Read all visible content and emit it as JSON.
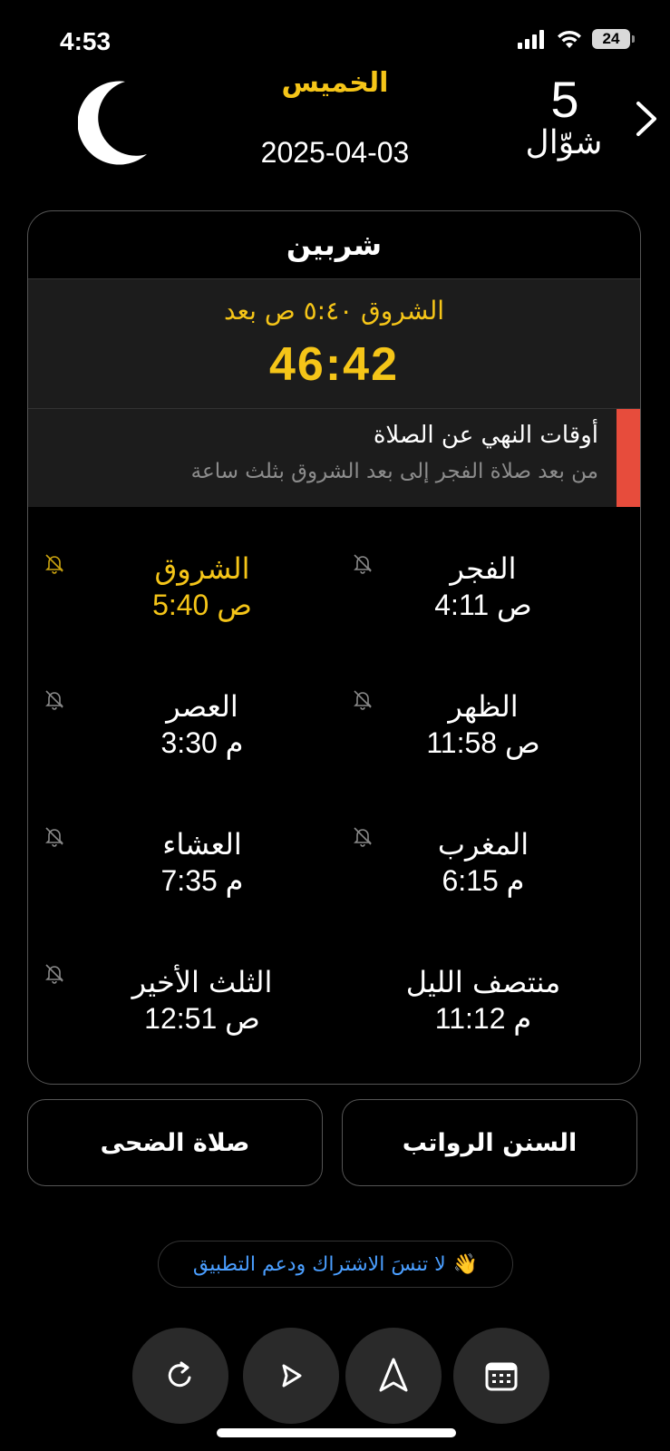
{
  "status": {
    "time": "4:53",
    "battery": "24"
  },
  "header": {
    "day": "الخميس",
    "gregorian_date": "2025-04-03",
    "hijri_day": "5",
    "hijri_month": "شوّال"
  },
  "card": {
    "city": "شربين",
    "next_label": "الشروق ٥:٤٠ ص بعد",
    "countdown": "46:42",
    "notice_title": "أوقات النهي عن الصلاة",
    "notice_sub": "من بعد صلاة الفجر إلى بعد الشروق بثلث ساعة",
    "prayers": [
      {
        "name": "الفجر",
        "time": "4:11 ص"
      },
      {
        "name": "الشروق",
        "time": "5:40 ص"
      },
      {
        "name": "الظهر",
        "time": "11:58 ص"
      },
      {
        "name": "العصر",
        "time": "3:30 م"
      },
      {
        "name": "المغرب",
        "time": "6:15 م"
      },
      {
        "name": "العشاء",
        "time": "7:35 م"
      },
      {
        "name": "منتصف الليل",
        "time": "11:12 م"
      },
      {
        "name": "الثلث الأخير",
        "time": "12:51 ص"
      }
    ]
  },
  "buttons": {
    "sunan": "السنن الرواتب",
    "duha": "صلاة الضحى"
  },
  "support": {
    "text": "لا تنسَ الاشتراك ودعم التطبيق",
    "emoji": "👋"
  },
  "icons": {
    "toolbar": [
      "calendar-icon",
      "compass-icon",
      "play-icon",
      "refresh-icon"
    ]
  },
  "colors": {
    "accent": "#f5c518",
    "notice": "#e74c3c",
    "link": "#4a9eff"
  }
}
